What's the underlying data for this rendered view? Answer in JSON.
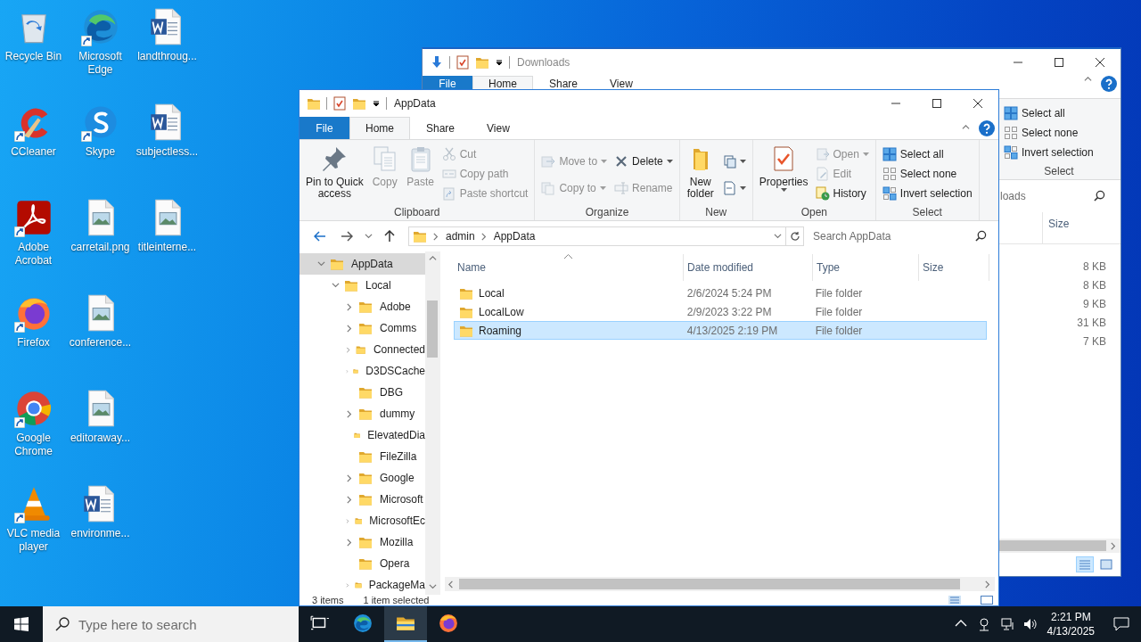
{
  "desktop": {
    "icons": [
      {
        "label": "Recycle Bin",
        "shortcut": false
      },
      {
        "label": "CCleaner",
        "shortcut": true
      },
      {
        "label": "Adobe Acrobat",
        "shortcut": true
      },
      {
        "label": "Firefox",
        "shortcut": true
      },
      {
        "label": "Google Chrome",
        "shortcut": true
      },
      {
        "label": "VLC media player",
        "shortcut": true
      },
      {
        "label": "Microsoft Edge",
        "shortcut": true
      },
      {
        "label": "Skype",
        "shortcut": true
      },
      {
        "label": "carretail.png",
        "shortcut": false
      },
      {
        "label": "conference...",
        "shortcut": false
      },
      {
        "label": "editoraway...",
        "shortcut": false
      },
      {
        "label": "environme...",
        "shortcut": false
      },
      {
        "label": "landthroug...",
        "shortcut": false
      },
      {
        "label": "subjectless...",
        "shortcut": false
      },
      {
        "label": "titleinterne...",
        "shortcut": false
      }
    ]
  },
  "downloads_window": {
    "title": "Downloads",
    "file_menu": "File",
    "tabs": [
      {
        "label": "Home",
        "selected": true
      },
      {
        "label": "Share",
        "selected": false
      },
      {
        "label": "View",
        "selected": false
      }
    ],
    "select_group": {
      "label": "Select",
      "items": [
        "Select all",
        "Select none",
        "Invert selection"
      ]
    },
    "search": {
      "placeholder": "loads"
    },
    "columns": [
      "Size"
    ],
    "sizes": [
      "8 KB",
      "8 KB",
      "9 KB",
      "31 KB",
      "7 KB"
    ]
  },
  "explorer_window": {
    "title": "AppData",
    "file_menu": "File",
    "tabs": [
      {
        "label": "Home",
        "selected": true
      },
      {
        "label": "Share",
        "selected": false
      },
      {
        "label": "View",
        "selected": false
      }
    ],
    "ribbon": [
      {
        "label": "Clipboard",
        "items": [
          {
            "kind": "large",
            "label": "Pin to Quick\naccess",
            "disabled": false,
            "menu": false
          },
          {
            "kind": "large",
            "label": "Copy",
            "disabled": true,
            "menu": false
          },
          {
            "kind": "large",
            "label": "Paste",
            "disabled": true,
            "menu": false
          },
          {
            "kind": "stack",
            "items": [
              {
                "label": "Cut",
                "disabled": true,
                "menu": false
              },
              {
                "label": "Copy path",
                "disabled": true,
                "menu": false
              },
              {
                "label": "Paste shortcut",
                "disabled": true,
                "menu": false
              }
            ]
          }
        ]
      },
      {
        "label": "Organize",
        "items": [
          {
            "kind": "stack",
            "items": [
              {
                "label": "Move to",
                "disabled": true,
                "menu": true
              },
              {
                "label": "Copy to",
                "disabled": true,
                "menu": true
              }
            ]
          },
          {
            "kind": "stack",
            "items": [
              {
                "label": "Delete",
                "disabled": false,
                "menu": true
              },
              {
                "label": "Rename",
                "disabled": true,
                "menu": false
              }
            ]
          }
        ]
      },
      {
        "label": "New",
        "items": [
          {
            "kind": "large",
            "label": "New\nfolder",
            "disabled": false,
            "menu": false
          },
          {
            "kind": "stack",
            "items": [
              {
                "disabled": false,
                "menu": true
              },
              {
                "disabled": false,
                "menu": true
              }
            ]
          }
        ]
      },
      {
        "label": "Open",
        "items": [
          {
            "kind": "large",
            "label": "Properties",
            "disabled": false,
            "menu": true
          },
          {
            "kind": "stack",
            "items": [
              {
                "label": "Open",
                "disabled": true,
                "menu": true
              },
              {
                "label": "Edit",
                "disabled": true,
                "menu": false
              },
              {
                "label": "History",
                "disabled": false,
                "menu": false
              }
            ]
          }
        ]
      },
      {
        "label": "Select",
        "items": [
          {
            "kind": "stack",
            "items": [
              {
                "label": "Select all",
                "disabled": false,
                "menu": false
              },
              {
                "label": "Select none",
                "disabled": false,
                "menu": false
              },
              {
                "label": "Invert selection",
                "disabled": false,
                "menu": false
              }
            ]
          }
        ]
      }
    ],
    "address": {
      "path": [
        "admin",
        "AppData"
      ],
      "search_placeholder": "Search AppData"
    },
    "tree": [
      {
        "label": "AppData",
        "selected": true,
        "expanded": true,
        "children": [
          {
            "label": "Local",
            "selected": false,
            "expanded": true,
            "children": [
              {
                "label": "Adobe",
                "selected": false,
                "expanded": false
              },
              {
                "label": "Comms",
                "selected": false,
                "expanded": false
              },
              {
                "label": "Connected",
                "selected": false,
                "expanded": false
              },
              {
                "label": "D3DSCache",
                "selected": false,
                "expanded": false
              },
              {
                "label": "DBG",
                "selected": false
              },
              {
                "label": "dummy",
                "selected": false,
                "expanded": false
              },
              {
                "label": "ElevatedDia",
                "selected": false
              },
              {
                "label": "FileZilla",
                "selected": false
              },
              {
                "label": "Google",
                "selected": false,
                "expanded": false
              },
              {
                "label": "Microsoft",
                "selected": false,
                "expanded": false
              },
              {
                "label": "MicrosoftEc",
                "selected": false,
                "expanded": false
              },
              {
                "label": "Mozilla",
                "selected": false,
                "expanded": false
              },
              {
                "label": "Opera",
                "selected": false
              },
              {
                "label": "PackageMa",
                "selected": false,
                "expanded": false
              }
            ]
          }
        ]
      }
    ],
    "columns": [
      "Name",
      "Date modified",
      "Type",
      "Size"
    ],
    "files": [
      {
        "name": "Local",
        "date": "2/6/2024 5:24 PM",
        "type": "File folder",
        "selected": false
      },
      {
        "name": "LocalLow",
        "date": "2/9/2023 3:22 PM",
        "type": "File folder",
        "selected": false
      },
      {
        "name": "Roaming",
        "date": "4/13/2025 2:19 PM",
        "type": "File folder",
        "selected": true
      }
    ],
    "status": [
      "3 items",
      "1 item selected"
    ]
  },
  "taskbar": {
    "search_placeholder": "Type here to search",
    "apps": [
      {
        "active": false
      },
      {
        "active": false
      },
      {
        "active": true
      },
      {
        "active": false
      }
    ],
    "time": "2:21 PM",
    "date": "4/13/2025"
  }
}
